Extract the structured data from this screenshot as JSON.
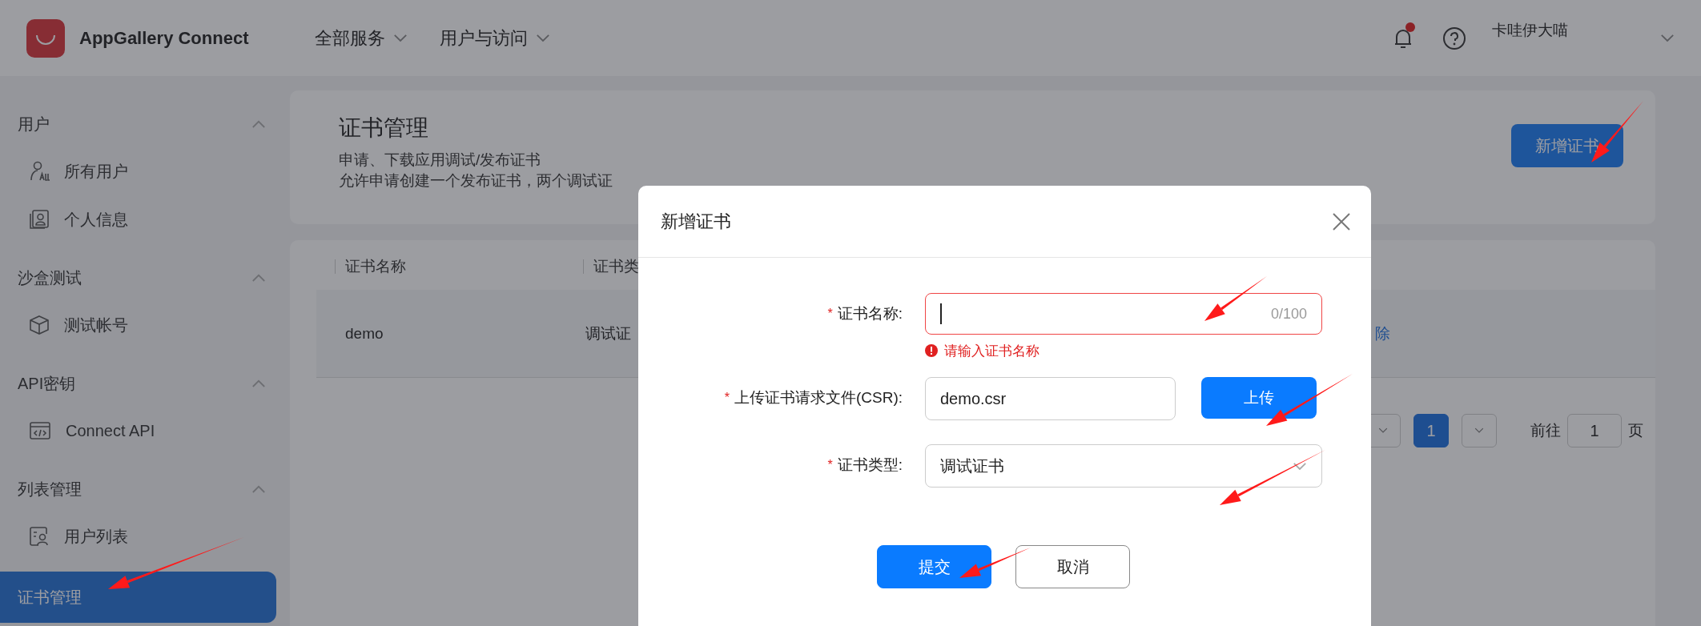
{
  "header": {
    "app_name": "AppGallery Connect",
    "nav": [
      {
        "label": "全部服务"
      },
      {
        "label": "用户与访问"
      }
    ],
    "notification_dot": true,
    "user": {
      "name": "卡哇伊大喵"
    }
  },
  "sidebar": {
    "sections": [
      {
        "kind": "group",
        "title": "用户",
        "expanded": true,
        "children": [
          {
            "label": "所有用户",
            "selected": false
          },
          {
            "label": "个人信息",
            "selected": false
          }
        ]
      },
      {
        "kind": "group",
        "title": "沙盒测试",
        "expanded": true,
        "children": [
          {
            "label": "测试帐号",
            "selected": false
          }
        ]
      },
      {
        "kind": "group",
        "title": "API密钥",
        "expanded": true,
        "children": [
          {
            "label": "Connect API",
            "selected": false
          }
        ]
      },
      {
        "kind": "group",
        "title": "列表管理",
        "expanded": true,
        "children": [
          {
            "label": "用户列表",
            "selected": false
          }
        ]
      },
      {
        "kind": "link",
        "label": "证书管理",
        "selected": true
      }
    ]
  },
  "page": {
    "title": "证书管理",
    "subtitle": "申请、下载应用调试/发布证书",
    "note": "允许申请创建一个发布证书，两个调试证",
    "new_button": "新增证书"
  },
  "table": {
    "columns": [
      "证书名称",
      "证书类"
    ],
    "rows": [
      {
        "cells": [
          "demo",
          "调试证"
        ],
        "action": "除"
      }
    ]
  },
  "pagination": {
    "pages": [
      {
        "label": "1",
        "selected": true
      }
    ],
    "goto_label": "前往",
    "goto_value": "1",
    "page_suffix": "页"
  },
  "dialog": {
    "title": "新增证书",
    "required_mark": "*",
    "fields": [
      {
        "kind": "text",
        "label": "证书名称:",
        "required": true,
        "counter": "0/100",
        "error": "请输入证书名称"
      },
      {
        "kind": "file",
        "label": "上传证书请求文件(CSR):",
        "required": true,
        "value": "demo.csr",
        "button": "上传"
      },
      {
        "kind": "select",
        "label": "证书类型:",
        "required": true,
        "value": "调试证书"
      }
    ],
    "buttons": [
      {
        "label": "提交",
        "primary": true
      },
      {
        "label": "取消",
        "primary": false
      }
    ]
  }
}
